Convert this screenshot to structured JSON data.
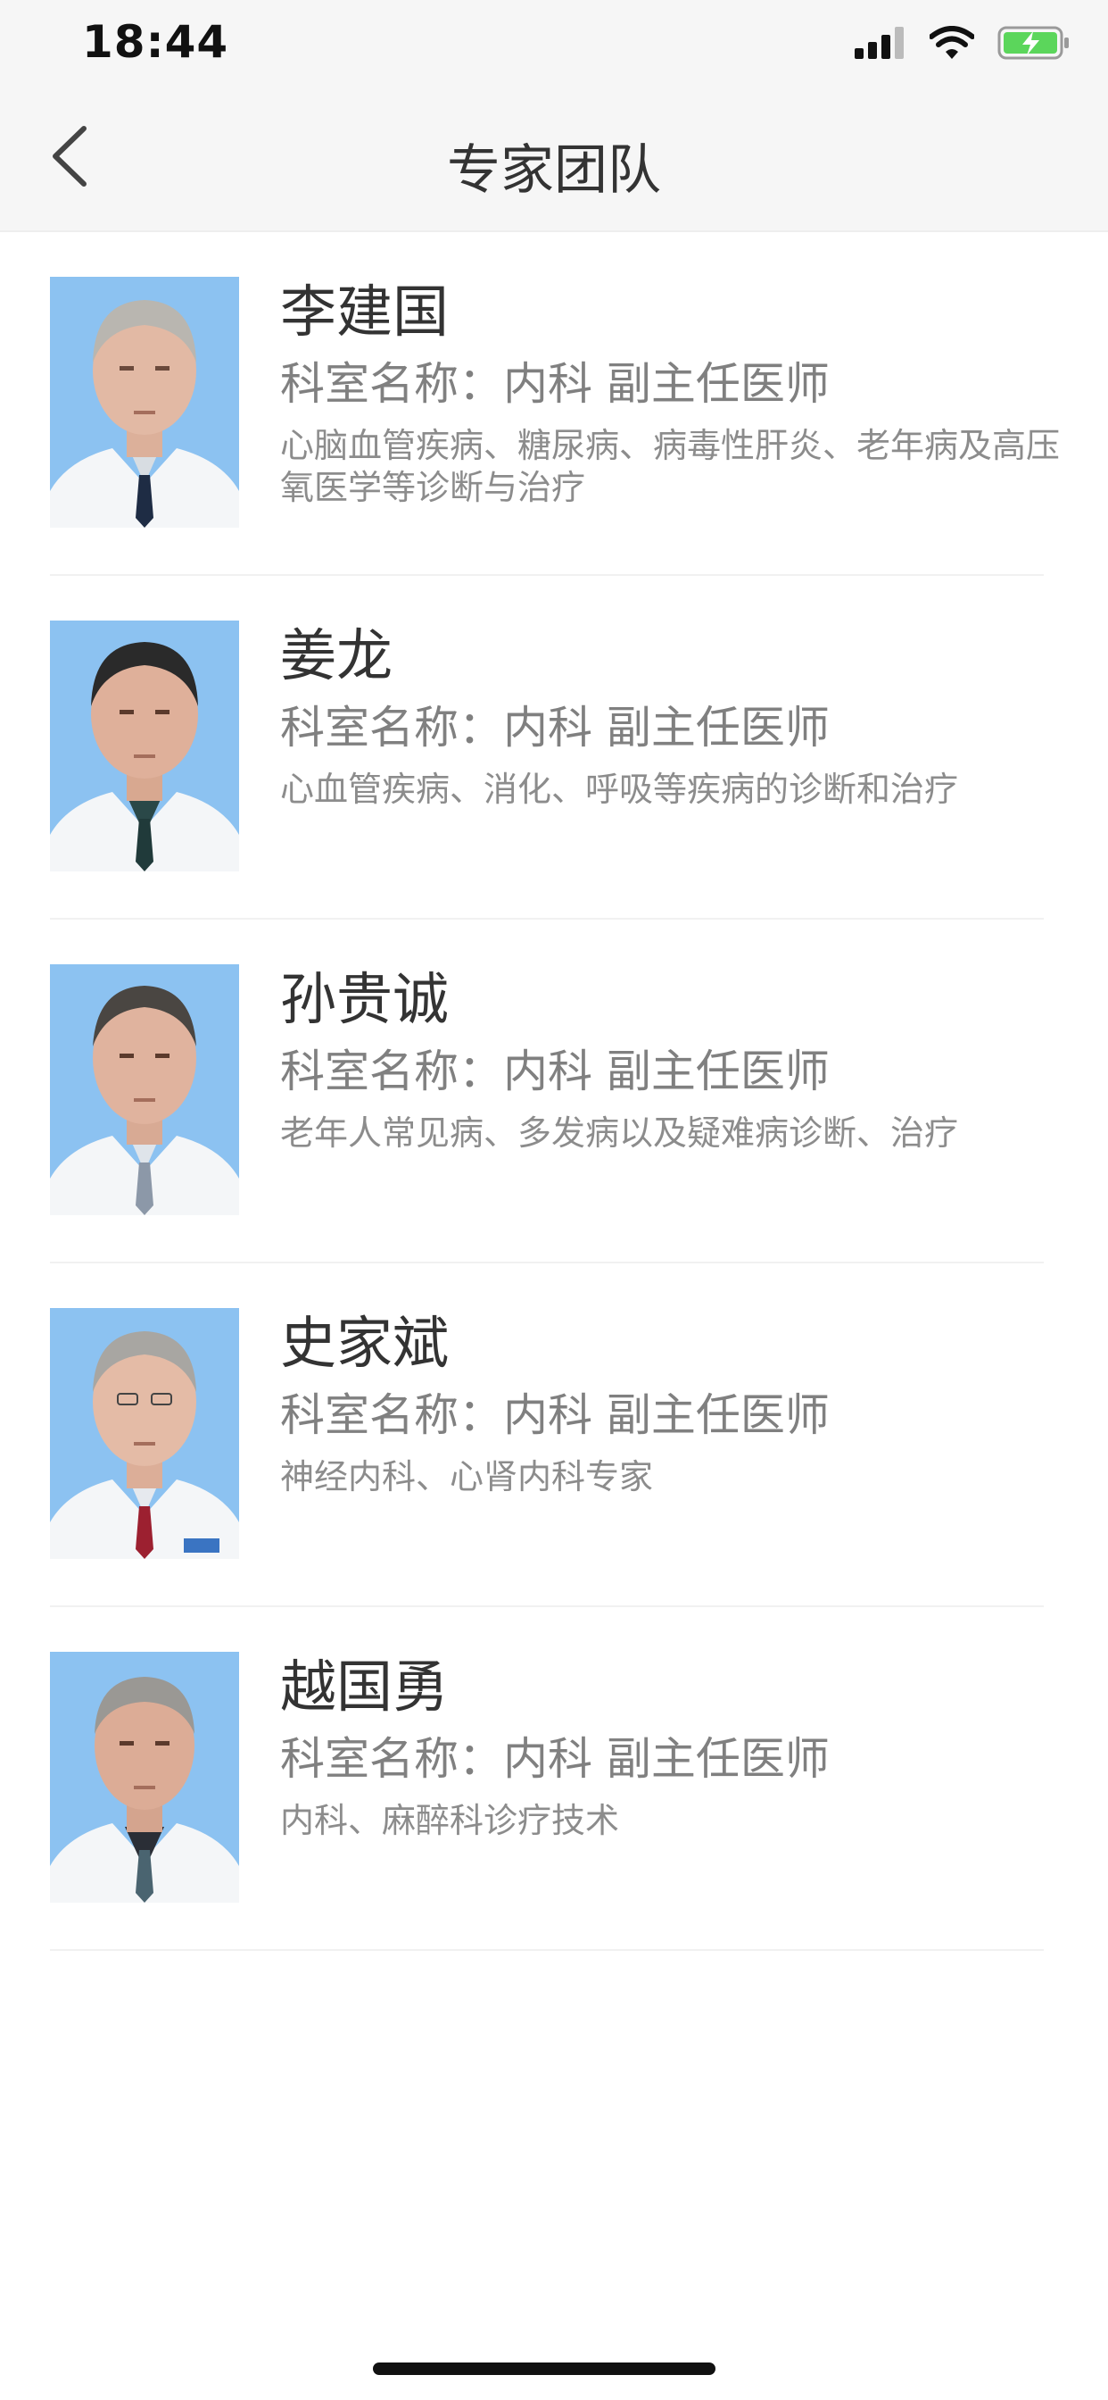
{
  "status_bar": {
    "time": "18:44",
    "icons": [
      "signal-icon",
      "wifi-icon",
      "battery-charging-icon"
    ]
  },
  "nav": {
    "title": "专家团队",
    "back_icon": "chevron-left-icon"
  },
  "colors": {
    "bar_background": "#f6f6f6",
    "photo_background": "#8cc2f1",
    "battery_green": "#5bd65b"
  },
  "doctors": [
    {
      "name": "李建国",
      "department": "科室名称：内科 副主任医师",
      "specialty": "心脑血管疾病、糖尿病、病毒性肝炎、老年病及高压氧医学等诊断与治疗",
      "tie_color": "#1e2c44"
    },
    {
      "name": "姜龙",
      "department": "科室名称：内科 副主任医师",
      "specialty": "心血管疾病、消化、呼吸等疾病的诊断和治疗",
      "tie_color": "#203a3a"
    },
    {
      "name": "孙贵诚",
      "department": "科室名称：内科 副主任医师",
      "specialty": "老年人常见病、多发病以及疑难病诊断、治疗",
      "tie_color": "#8c98a8"
    },
    {
      "name": "史家斌",
      "department": "科室名称：内科 副主任医师",
      "specialty": "神经内科、心肾内科专家",
      "tie_color": "#9c2030"
    },
    {
      "name": "越国勇",
      "department": "科室名称：内科 副主任医师",
      "specialty": "内科、麻醉科诊疗技术",
      "tie_color": "#4a6470"
    }
  ]
}
